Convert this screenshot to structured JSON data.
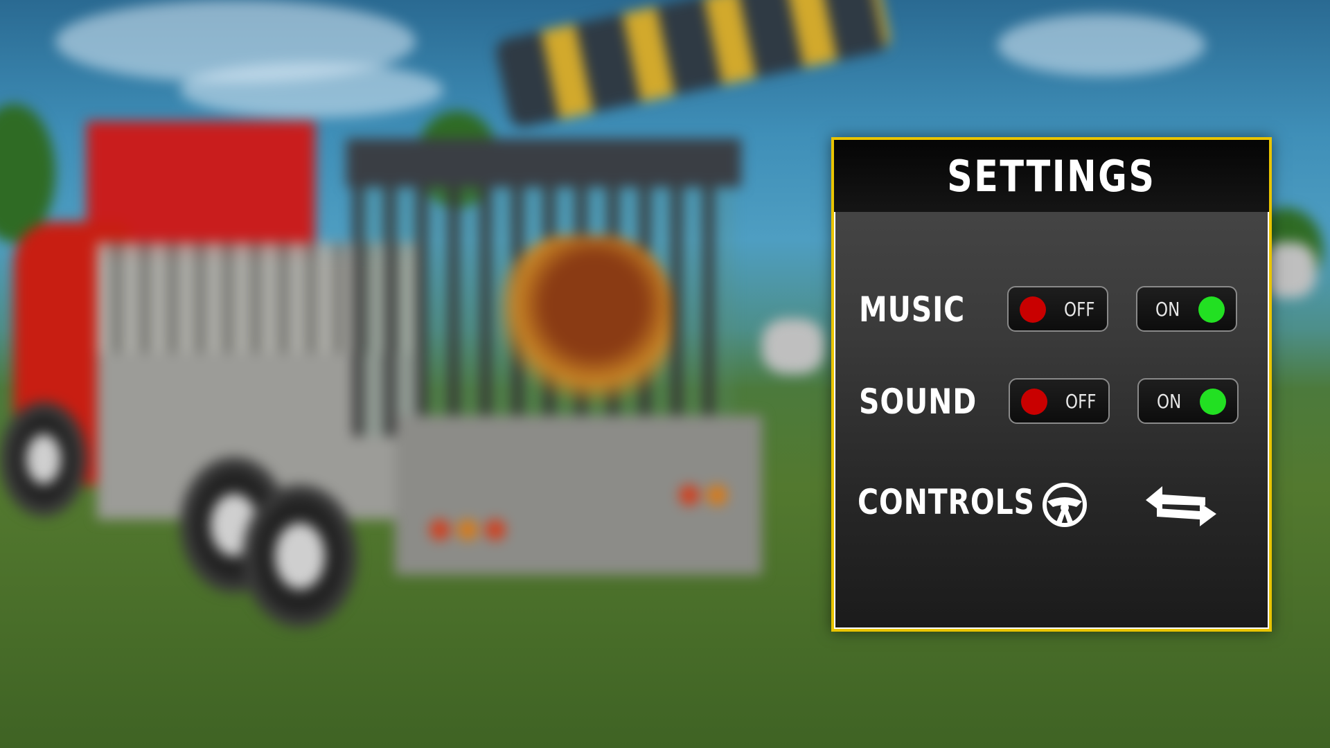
{
  "settings": {
    "title": "SETTINGS",
    "music": {
      "label": "MUSIC",
      "off_label": "OFF",
      "on_label": "ON",
      "selected": "on"
    },
    "sound": {
      "label": "SOUND",
      "off_label": "OFF",
      "on_label": "ON",
      "selected": "on"
    },
    "controls": {
      "label": "CONTROLS",
      "options": [
        "steering-wheel-icon",
        "swap-arrows-icon"
      ]
    }
  },
  "colors": {
    "panel_border": "#e9c400",
    "off_indicator": "#c90000",
    "on_indicator": "#22e022",
    "text": "#ffffff"
  }
}
